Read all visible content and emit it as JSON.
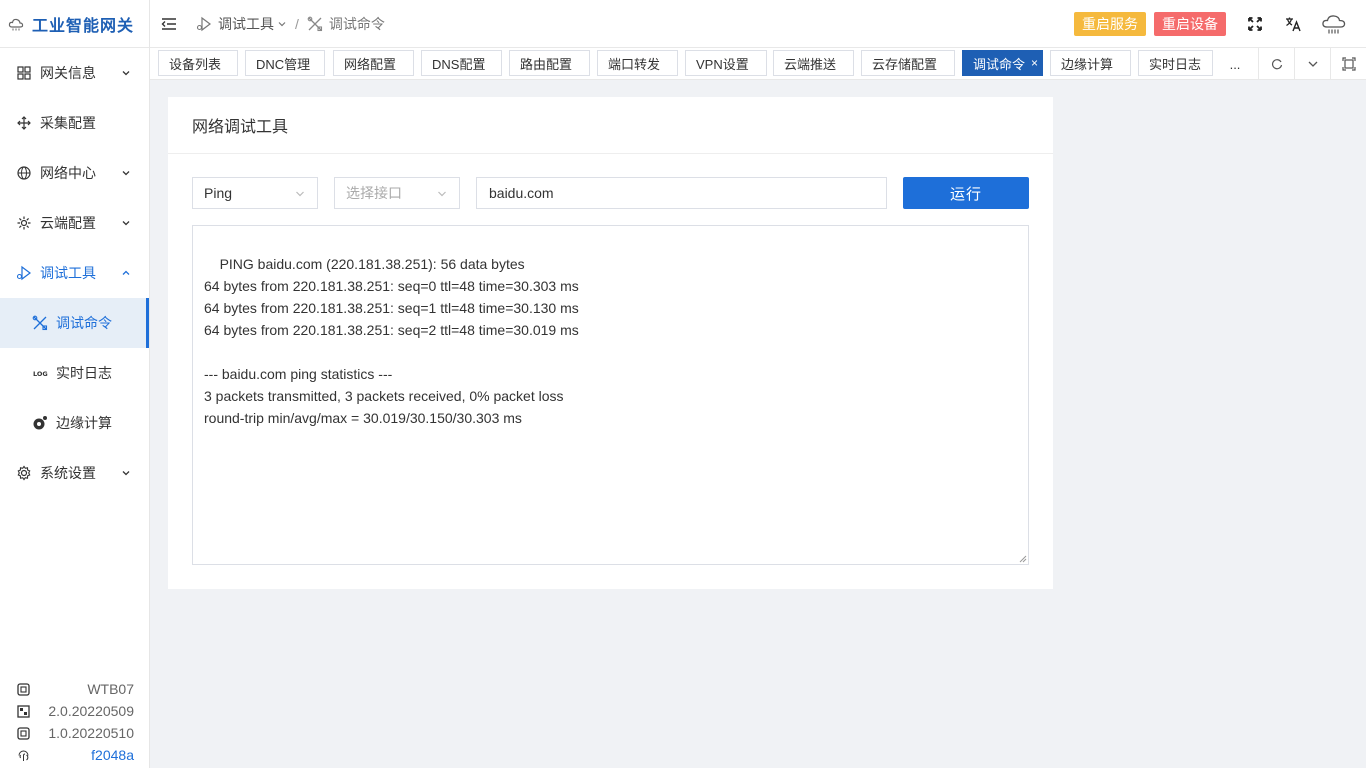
{
  "app": {
    "title": "工业智能网关"
  },
  "sidebar": {
    "items": [
      {
        "label": "网关信息",
        "icon": "grid-icon",
        "expandable": true
      },
      {
        "label": "采集配置",
        "icon": "move-icon",
        "expandable": false
      },
      {
        "label": "网络中心",
        "icon": "globe-icon",
        "expandable": true
      },
      {
        "label": "云端配置",
        "icon": "cloud-config-icon",
        "expandable": true
      },
      {
        "label": "调试工具",
        "icon": "debug-icon",
        "expandable": true,
        "open": true
      },
      {
        "label": "调试命令",
        "icon": "tools-icon",
        "sub": true,
        "active": true
      },
      {
        "label": "实时日志",
        "icon": "log-icon",
        "sub": true
      },
      {
        "label": "边缘计算",
        "icon": "edge-icon",
        "sub": true
      },
      {
        "label": "系统设置",
        "icon": "settings-icon",
        "expandable": true
      }
    ],
    "footer": [
      {
        "icon": "chip-icon",
        "value": "WTB07"
      },
      {
        "icon": "firmware-icon",
        "value": "2.0.20220509"
      },
      {
        "icon": "chip-icon",
        "value": "1.0.20220510"
      },
      {
        "icon": "fingerprint-icon",
        "value": "f2048a"
      }
    ]
  },
  "header": {
    "breadcrumb": [
      "调试工具",
      "调试命令"
    ],
    "restart_service": "重启服务",
    "restart_device": "重启设备"
  },
  "tabs": [
    "设备列表",
    "DNC管理",
    "网络配置",
    "DNS配置",
    "路由配置",
    "端口转发",
    "VPN设置",
    "云端推送",
    "云存储配置",
    "调试命令",
    "边缘计算",
    "实时日志"
  ],
  "tabs_active": "调试命令",
  "tabs_more": "...",
  "main": {
    "card_title": "网络调试工具",
    "tool_select": "Ping",
    "interface_placeholder": "选择接口",
    "host_value": "baidu.com",
    "run_label": "运行",
    "output": "PING baidu.com (220.181.38.251): 56 data bytes\n64 bytes from 220.181.38.251: seq=0 ttl=48 time=30.303 ms\n64 bytes from 220.181.38.251: seq=1 ttl=48 time=30.130 ms\n64 bytes from 220.181.38.251: seq=2 ttl=48 time=30.019 ms\n\n--- baidu.com ping statistics ---\n3 packets transmitted, 3 packets received, 0% packet loss\nround-trip min/avg/max = 30.019/30.150/30.303 ms"
  },
  "colors": {
    "primary": "#1e6fd9",
    "warning": "#f5b93d",
    "danger": "#f56b6b"
  }
}
